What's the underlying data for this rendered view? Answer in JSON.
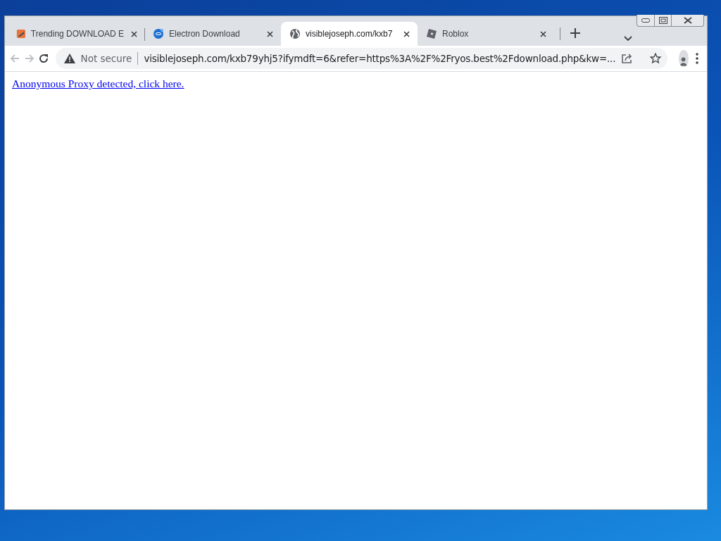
{
  "tabs": [
    {
      "kind": "flame",
      "title": "Trending DOWNLOAD E",
      "selected": false
    },
    {
      "kind": "electron",
      "title": "Electron Download",
      "selected": false
    },
    {
      "kind": "globe",
      "title": "visiblejoseph.com/kxb7",
      "selected": true
    },
    {
      "kind": "roblox",
      "title": "Roblox",
      "selected": false
    }
  ],
  "address_bar": {
    "security": "Not secure",
    "url": "visiblejoseph.com/kxb79yhj5?ifymdft=6&refer=https%3A%2F%2Fryos.best%2Fdownload.php&kw=..."
  },
  "page": {
    "link": "Anonymous Proxy detected, click here."
  }
}
